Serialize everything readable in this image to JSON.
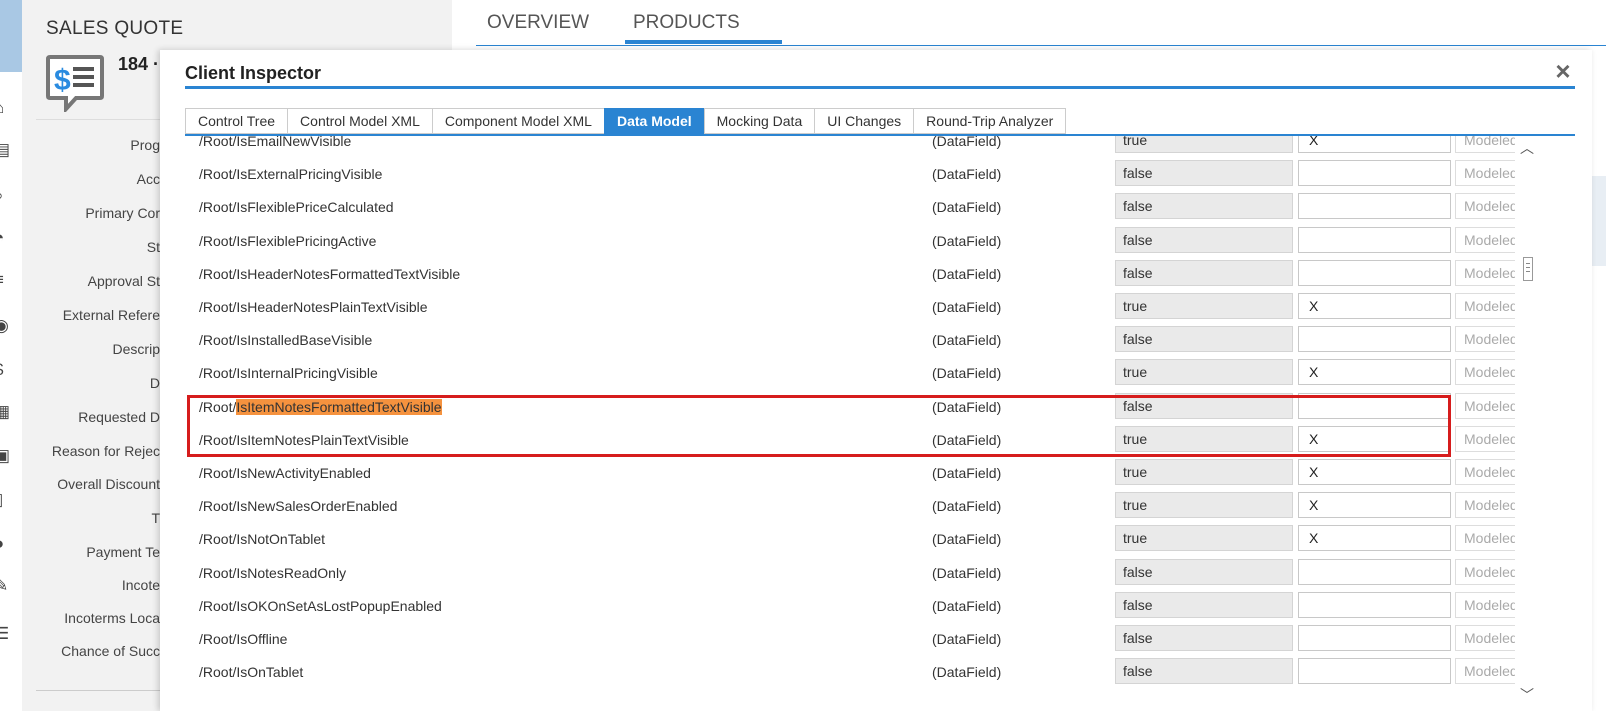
{
  "sales_quote": {
    "title": "SALES QUOTE",
    "number": "184 ·",
    "labels": [
      "Prog",
      "Acc",
      "Primary Cor",
      "St",
      "Approval St",
      "External Refere",
      "Descrip",
      "D",
      "Requested D",
      "Reason for Rejec",
      "Overall Discount",
      "T",
      "Payment Te",
      "Incote",
      "Incoterms Loca",
      "Chance of Succ"
    ]
  },
  "top_tabs": [
    "OVERVIEW",
    "PRODUCTS"
  ],
  "dialog": {
    "title": "Client Inspector",
    "close_label": "×",
    "tabs": [
      {
        "label": "Control Tree",
        "active": false
      },
      {
        "label": "Control Model XML",
        "active": false
      },
      {
        "label": "Component Model XML",
        "active": false
      },
      {
        "label": "Data Model",
        "active": true
      },
      {
        "label": "Mocking Data",
        "active": false
      },
      {
        "label": "UI Changes",
        "active": false
      },
      {
        "label": "Round-Trip Analyzer",
        "active": false
      }
    ],
    "model_placeholder": "Modeled",
    "rows": [
      {
        "prefix": "/Root/",
        "name": "IsEmailNewVisible",
        "type": "(DataField)",
        "value": "true",
        "flag": "X"
      },
      {
        "prefix": "/Root/",
        "name": "IsExternalPricingVisible",
        "type": "(DataField)",
        "value": "false",
        "flag": ""
      },
      {
        "prefix": "/Root/",
        "name": "IsFlexiblePriceCalculated",
        "type": "(DataField)",
        "value": "false",
        "flag": ""
      },
      {
        "prefix": "/Root/",
        "name": "IsFlexiblePricingActive",
        "type": "(DataField)",
        "value": "false",
        "flag": ""
      },
      {
        "prefix": "/Root/",
        "name": "IsHeaderNotesFormattedTextVisible",
        "type": "(DataField)",
        "value": "false",
        "flag": ""
      },
      {
        "prefix": "/Root/",
        "name": "IsHeaderNotesPlainTextVisible",
        "type": "(DataField)",
        "value": "true",
        "flag": "X"
      },
      {
        "prefix": "/Root/",
        "name": "IsInstalledBaseVisible",
        "type": "(DataField)",
        "value": "false",
        "flag": ""
      },
      {
        "prefix": "/Root/",
        "name": "IsInternalPricingVisible",
        "type": "(DataField)",
        "value": "true",
        "flag": "X"
      },
      {
        "prefix": "/Root/",
        "name": "IsItemNotesFormattedTextVisible",
        "type": "(DataField)",
        "value": "false",
        "flag": "",
        "highlighted": true
      },
      {
        "prefix": "/Root/",
        "name": "IsItemNotesPlainTextVisible",
        "type": "(DataField)",
        "value": "true",
        "flag": "X"
      },
      {
        "prefix": "/Root/",
        "name": "IsNewActivityEnabled",
        "type": "(DataField)",
        "value": "true",
        "flag": "X"
      },
      {
        "prefix": "/Root/",
        "name": "IsNewSalesOrderEnabled",
        "type": "(DataField)",
        "value": "true",
        "flag": "X"
      },
      {
        "prefix": "/Root/",
        "name": "IsNotOnTablet",
        "type": "(DataField)",
        "value": "true",
        "flag": "X"
      },
      {
        "prefix": "/Root/",
        "name": "IsNotesReadOnly",
        "type": "(DataField)",
        "value": "false",
        "flag": ""
      },
      {
        "prefix": "/Root/",
        "name": "IsOKOnSetAsLostPopupEnabled",
        "type": "(DataField)",
        "value": "false",
        "flag": ""
      },
      {
        "prefix": "/Root/",
        "name": "IsOffline",
        "type": "(DataField)",
        "value": "false",
        "flag": ""
      },
      {
        "prefix": "/Root/",
        "name": "IsOnTablet",
        "type": "(DataField)",
        "value": "false",
        "flag": ""
      }
    ]
  },
  "colors": {
    "accent": "#2a84d2",
    "highlight_text": "#f5923e",
    "highlight_box": "#d61c1c"
  },
  "icons": [
    "home-icon",
    "clipboard-icon",
    "search-icon",
    "clock-icon",
    "list-icon",
    "target-icon",
    "dollar-icon",
    "document-icon",
    "calendar-icon",
    "tablet-icon",
    "headset-icon",
    "badge-icon",
    "notes-icon"
  ]
}
